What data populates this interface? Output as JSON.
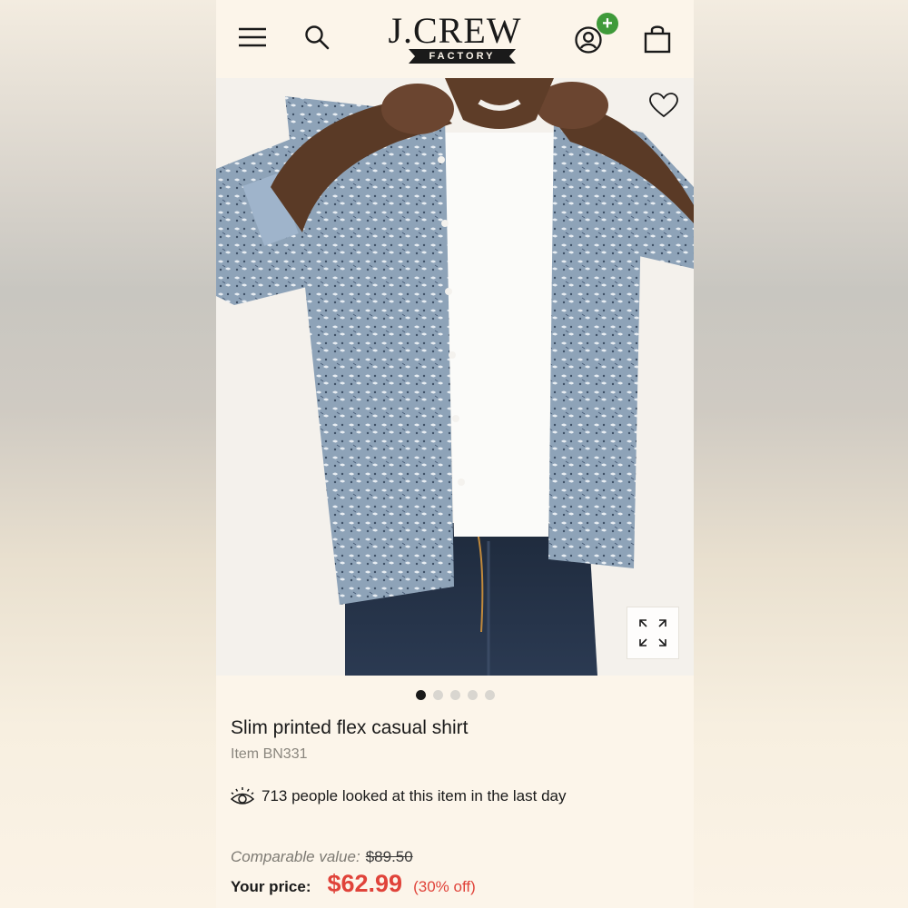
{
  "header": {
    "logo_main": "J.CREW",
    "logo_sub": "FACTORY",
    "icons": [
      "menu-icon",
      "search-icon",
      "account-icon",
      "plus-icon",
      "bag-icon"
    ],
    "plus_badge": "+"
  },
  "product": {
    "title": "Slim printed flex casual shirt",
    "item_code": "Item BN331",
    "views_text": "713 people looked at this item in the last day",
    "comparable_label": "Comparable value:",
    "comparable_price": "$89.50",
    "price_label": "Your price:",
    "price": "$62.99",
    "discount": "(30% off)"
  },
  "carousel": {
    "count": 5,
    "active_index": 0
  },
  "colors": {
    "accent": "#e0433a",
    "badge_green": "#3f9a3a",
    "background": "#fcf5ea",
    "text": "#1a1a1a"
  }
}
